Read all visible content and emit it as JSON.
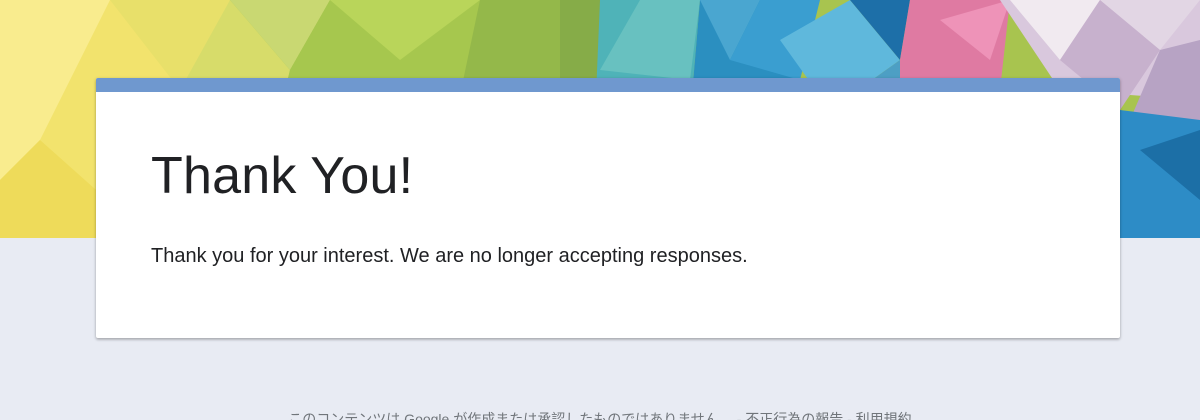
{
  "theme": {
    "accent": "#6f98cf",
    "background": "#e8ebf3"
  },
  "confirmation": {
    "title": "Thank You!",
    "message": "Thank you for your interest. We are no longer accepting responses."
  },
  "footer": {
    "disclaimer": "このコンテンツは Google が作成または承認したものではありません。 - 不正行為の報告 - 利用規約"
  }
}
